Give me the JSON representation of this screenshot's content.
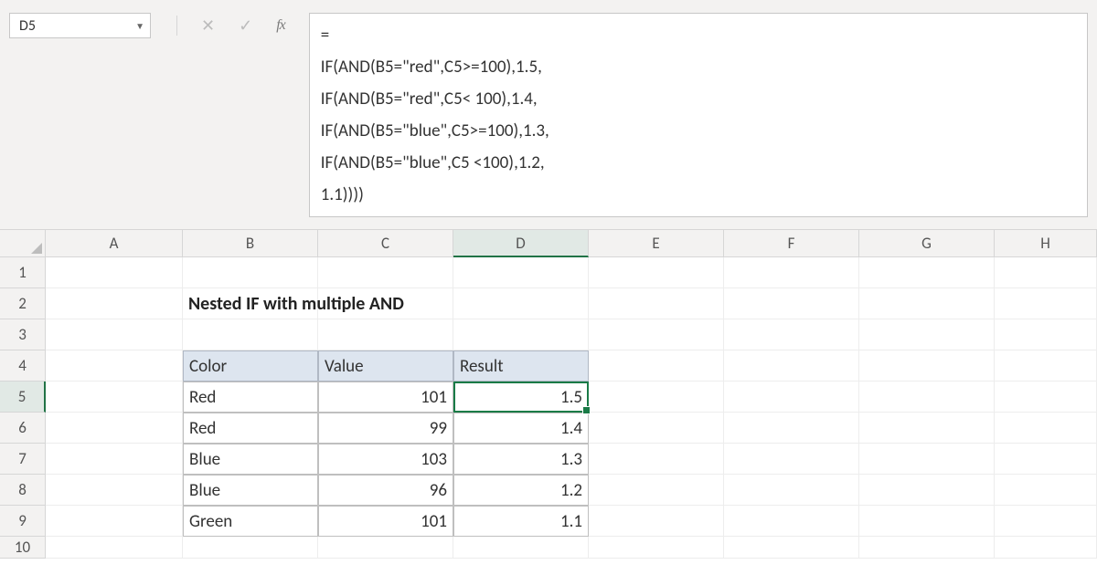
{
  "active_cell": "D5",
  "formula_lines": [
    "=",
    "IF(AND(B5=\"red\",C5>=100),1.5,",
    "IF(AND(B5=\"red\",C5< 100),1.4,",
    "IF(AND(B5=\"blue\",C5>=100),1.3,",
    "IF(AND(B5=\"blue\",C5 <100),1.2,",
    "1.1))))"
  ],
  "columns": [
    "A",
    "B",
    "C",
    "D",
    "E",
    "F",
    "G",
    "H"
  ],
  "rows": [
    "1",
    "2",
    "3",
    "4",
    "5",
    "6",
    "7",
    "8",
    "9",
    "10"
  ],
  "title": "Nested IF with multiple AND",
  "headers": {
    "color": "Color",
    "value": "Value",
    "result": "Result"
  },
  "data": [
    {
      "color": "Red",
      "value": "101",
      "result": "1.5"
    },
    {
      "color": "Red",
      "value": "99",
      "result": "1.4"
    },
    {
      "color": "Blue",
      "value": "103",
      "result": "1.3"
    },
    {
      "color": "Blue",
      "value": "96",
      "result": "1.2"
    },
    {
      "color": "Green",
      "value": "101",
      "result": "1.1"
    }
  ],
  "selected_column": "D",
  "selected_row": "5"
}
